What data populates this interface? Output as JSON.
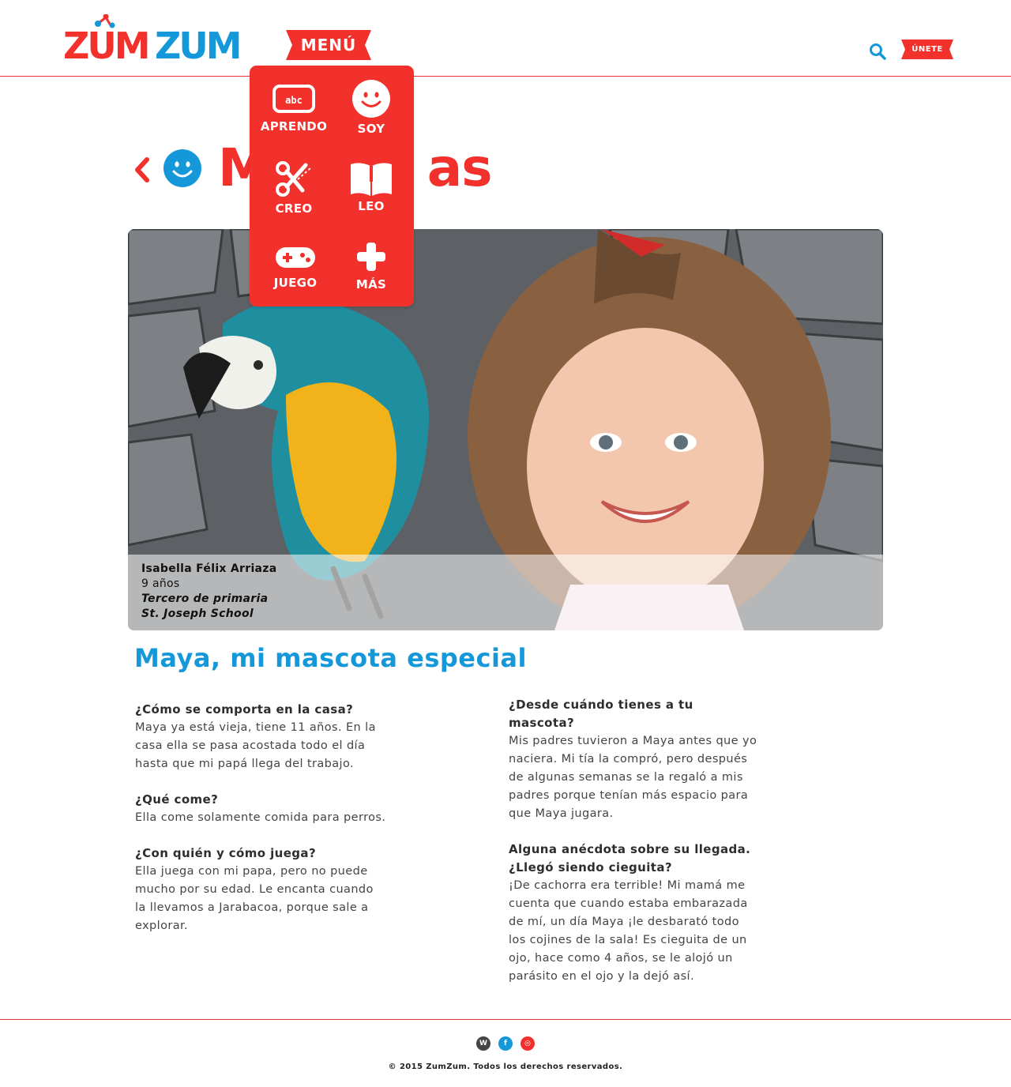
{
  "header": {
    "logo_text": "ZUMZUM",
    "menu_label": "MENÚ",
    "join_label": "ÚNETE"
  },
  "menu": {
    "items": [
      {
        "label": "APRENDO",
        "icon": "abc-board-icon"
      },
      {
        "label": "SOY",
        "icon": "smiley-icon"
      },
      {
        "label": "CREO",
        "icon": "scissors-icon"
      },
      {
        "label": "LEO",
        "icon": "book-icon"
      },
      {
        "label": "JUEGO",
        "icon": "gamepad-icon"
      },
      {
        "label": "MÁS",
        "icon": "plus-icon"
      }
    ]
  },
  "page": {
    "title_visible_start": "M",
    "title_visible_end": "as"
  },
  "hero": {
    "name": "Isabella Félix Arriaza",
    "age": "9 años",
    "grade": "Tercero de primaria",
    "school": "St. Joseph School"
  },
  "article": {
    "title": "Maya, mi mascota especial",
    "left": [
      {
        "q": "¿Cómo se comporta en la casa?",
        "a": "Maya ya está vieja, tiene 11 años. En la casa ella se pasa acostada todo el día hasta que mi papá llega del trabajo."
      },
      {
        "q": "¿Qué come?",
        "a": "Ella come solamente comida para perros."
      },
      {
        "q": "¿Con quién y cómo juega?",
        "a": "Ella juega con mi papa, pero no puede mucho por su edad. Le encanta cuando la llevamos a Jarabacoa, porque sale a explorar."
      }
    ],
    "right": [
      {
        "q": "¿Desde cuándo tienes a tu mascota?",
        "a": "Mis padres tuvieron a Maya antes que yo naciera. Mi tía la compró, pero después de algunas semanas se la regaló a mis padres porque tenían más espacio para que Maya jugara."
      },
      {
        "q": "Alguna anécdota sobre su llegada. ¿Llegó siendo cieguita?",
        "a": "¡De cachorra era terrible! Mi mamá me cuenta que cuando estaba embarazada de mí, un día Maya ¡le desbarató todo los cojines de la sala! Es cieguita de un ojo, hace como 4 años, se le alojó un parásito en el ojo y la dejó así."
      }
    ]
  },
  "footer": {
    "social": [
      {
        "icon": "wordpress-icon",
        "glyph": "W",
        "color": "#444444"
      },
      {
        "icon": "facebook-icon",
        "glyph": "f",
        "color": "#1598d9"
      },
      {
        "icon": "instagram-icon",
        "glyph": "◎",
        "color": "#f2312c"
      }
    ],
    "copyright": "© 2015 ZumZum. Todos los derechos reservados."
  },
  "colors": {
    "brand_red": "#f2312c",
    "brand_blue": "#1598d9"
  }
}
